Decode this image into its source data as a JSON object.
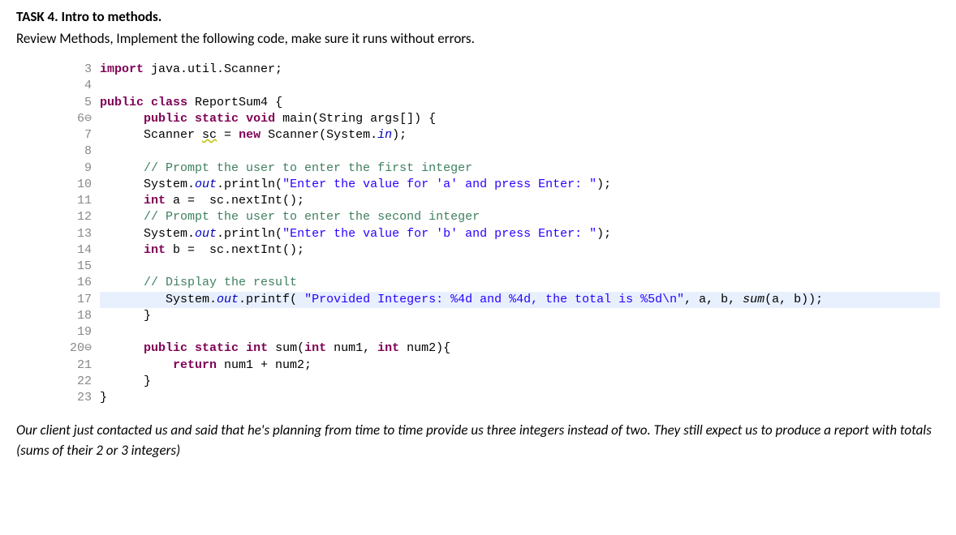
{
  "task": {
    "title": "TASK 4. Intro to methods.",
    "desc": "Review Methods, Implement the following code, make sure it runs without errors."
  },
  "code": {
    "lines": [
      {
        "n": "3",
        "marker": "",
        "hl": false,
        "tokens": [
          [
            "kw",
            "import"
          ],
          [
            "",
            " java.util.Scanner;"
          ]
        ]
      },
      {
        "n": "4",
        "marker": "",
        "hl": false,
        "tokens": [
          [
            "",
            ""
          ]
        ]
      },
      {
        "n": "5",
        "marker": "",
        "hl": false,
        "tokens": [
          [
            "kw",
            "public"
          ],
          [
            "",
            " "
          ],
          [
            "kw",
            "class"
          ],
          [
            "",
            " ReportSum4 {"
          ]
        ]
      },
      {
        "n": "6",
        "marker": "⊖",
        "hl": false,
        "tokens": [
          [
            "",
            "      "
          ],
          [
            "kw",
            "public"
          ],
          [
            "",
            " "
          ],
          [
            "kw",
            "static"
          ],
          [
            "",
            " "
          ],
          [
            "kw",
            "void"
          ],
          [
            "",
            " main(String args[]) {"
          ]
        ]
      },
      {
        "n": "7",
        "marker": "",
        "hl": false,
        "tokens": [
          [
            "",
            "      Scanner "
          ],
          [
            "squiggle",
            "sc"
          ],
          [
            "",
            " = "
          ],
          [
            "kw",
            "new"
          ],
          [
            "",
            " Scanner(System."
          ],
          [
            "sf",
            "in"
          ],
          [
            "",
            ");"
          ]
        ]
      },
      {
        "n": "8",
        "marker": "",
        "hl": false,
        "tokens": [
          [
            "",
            ""
          ]
        ]
      },
      {
        "n": "9",
        "marker": "",
        "hl": false,
        "tokens": [
          [
            "",
            "      "
          ],
          [
            "cm",
            "// Prompt the user to enter the first integer"
          ]
        ]
      },
      {
        "n": "10",
        "marker": "",
        "hl": false,
        "tokens": [
          [
            "",
            "      System."
          ],
          [
            "sf",
            "out"
          ],
          [
            "",
            ".println("
          ],
          [
            "str",
            "\"Enter the value for 'a' and press Enter: \""
          ],
          [
            "",
            ");"
          ]
        ]
      },
      {
        "n": "11",
        "marker": "",
        "hl": false,
        "tokens": [
          [
            "",
            "      "
          ],
          [
            "kw",
            "int"
          ],
          [
            "",
            " a =  sc.nextInt();"
          ]
        ]
      },
      {
        "n": "12",
        "marker": "",
        "hl": false,
        "tokens": [
          [
            "",
            "      "
          ],
          [
            "cm",
            "// Prompt the user to enter the second integer"
          ]
        ]
      },
      {
        "n": "13",
        "marker": "",
        "hl": false,
        "tokens": [
          [
            "",
            "      System."
          ],
          [
            "sf",
            "out"
          ],
          [
            "",
            ".println("
          ],
          [
            "str",
            "\"Enter the value for 'b' and press Enter: \""
          ],
          [
            "",
            ");"
          ]
        ]
      },
      {
        "n": "14",
        "marker": "",
        "hl": false,
        "tokens": [
          [
            "",
            "      "
          ],
          [
            "kw",
            "int"
          ],
          [
            "",
            " b =  sc.nextInt();"
          ]
        ]
      },
      {
        "n": "15",
        "marker": "",
        "hl": false,
        "tokens": [
          [
            "",
            ""
          ]
        ]
      },
      {
        "n": "16",
        "marker": "",
        "hl": false,
        "tokens": [
          [
            "",
            "      "
          ],
          [
            "cm",
            "// Display the result"
          ]
        ]
      },
      {
        "n": "17",
        "marker": "",
        "hl": true,
        "tokens": [
          [
            "",
            "         System."
          ],
          [
            "sf",
            "out"
          ],
          [
            "",
            ".printf( "
          ],
          [
            "str",
            "\"Provided Integers: %4d and %4d, the total is %5d\\n\""
          ],
          [
            "",
            ", a, b, "
          ],
          [
            "mth",
            "sum"
          ],
          [
            "",
            "(a, b));"
          ]
        ]
      },
      {
        "n": "18",
        "marker": "",
        "hl": false,
        "tokens": [
          [
            "",
            "      }"
          ]
        ]
      },
      {
        "n": "19",
        "marker": "",
        "hl": false,
        "tokens": [
          [
            "",
            ""
          ]
        ]
      },
      {
        "n": "20",
        "marker": "⊖",
        "hl": false,
        "tokens": [
          [
            "",
            "      "
          ],
          [
            "kw",
            "public"
          ],
          [
            "",
            " "
          ],
          [
            "kw",
            "static"
          ],
          [
            "",
            " "
          ],
          [
            "kw",
            "int"
          ],
          [
            "",
            " sum("
          ],
          [
            "kw",
            "int"
          ],
          [
            "",
            " num1, "
          ],
          [
            "kw",
            "int"
          ],
          [
            "",
            " num2){"
          ]
        ]
      },
      {
        "n": "21",
        "marker": "",
        "hl": false,
        "tokens": [
          [
            "",
            "          "
          ],
          [
            "kw",
            "return"
          ],
          [
            "",
            " num1 + num2;"
          ]
        ]
      },
      {
        "n": "22",
        "marker": "",
        "hl": false,
        "tokens": [
          [
            "",
            "      }"
          ]
        ]
      },
      {
        "n": "23",
        "marker": "",
        "hl": false,
        "tokens": [
          [
            "",
            "}"
          ]
        ]
      }
    ]
  },
  "footer": "Our client just contacted us and said that he's planning from time to time provide us three integers instead of two. They still expect us to produce a report with totals (sums of their 2 or 3 integers)"
}
